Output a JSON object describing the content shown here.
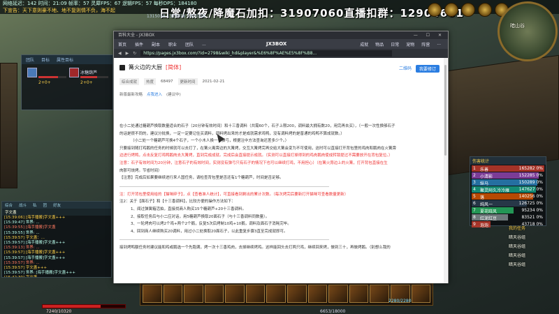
{
  "hud": {
    "top_line1": "网络延迟：142  时间：21:09  帧率：57  灵犀FPS：67  逻辑FPS：57  每秒DPS：184180",
    "top_line2": "下宣告：天下意则豪不地、地不复则情不负，海不起",
    "stream_title": "日常/熬夜/降魔石加扣：31907060直播扣群：12904681",
    "coords": "1315018 1315018 1315018",
    "minimap_label": "暗山谷",
    "party_tabs": [
      "团队",
      "目标",
      "属性目标"
    ],
    "party_members": [
      {
        "name": "",
        "level": "2+0+",
        "hp": 0.7,
        "icon_color": "#4a7ab8"
      },
      {
        "name": "冰糖葫芦",
        "level": "2+0+",
        "hp": 0.6,
        "icon_color": "#a0282a"
      }
    ],
    "chat_tabs": [
      "综合",
      "战斗",
      "私",
      "团",
      "好友"
    ],
    "chat_channel": "字文盏",
    "chat_lines": [
      {
        "text": "[15:39:06] [海手播搬]字文盏+++",
        "cls": "y"
      },
      {
        "text": "[15:39:47] 世界: ...",
        "cls": ""
      },
      {
        "text": "[15:39:55] [海手播搬]字文盏",
        "cls": "r"
      },
      {
        "text": "[15:39:55] 世界: ...",
        "cls": ""
      },
      {
        "text": "[15:39:57] 字文盏：...",
        "cls": "y"
      },
      {
        "text": "[15:39:57] [海手播搬]字文盏+++",
        "cls": ""
      },
      {
        "text": "[15:39:13] 世界: ...",
        "cls": "r"
      },
      {
        "text": "[15:39:57] [海手播搬]字文盏+++",
        "cls": "y"
      },
      {
        "text": "[15:39:57] [海手播搬]字文盏+++",
        "cls": ""
      },
      {
        "text": "[15:39:57] 世界: ...",
        "cls": "r"
      },
      {
        "text": "[15:39:57] 字文盏+++",
        "cls": "y"
      },
      {
        "text": "[15:39:57] 世界: [海手播搬]字文盏+++",
        "cls": ""
      },
      {
        "text": "[15:42:30] 字文盏",
        "cls": "y"
      }
    ],
    "damage_title": "伤害统计",
    "damage_rows": [
      {
        "rank": "1",
        "name": "乐善",
        "value": "165282 0%",
        "frac": 1.0,
        "color": "#c0392b"
      },
      {
        "rank": "2",
        "name": "小清影",
        "value": "152285 0%",
        "frac": 0.92,
        "color": "#8e44ad"
      },
      {
        "rank": "3",
        "name": "纵马",
        "value": "150289 0%",
        "frac": 0.9,
        "color": "#2980b9"
      },
      {
        "rank": "4",
        "name": "聚灵阿久冷冷雁",
        "value": "147627 0%",
        "frac": 0.88,
        "color": "#16a085"
      },
      {
        "rank": "5",
        "name": "落",
        "value": "140256 0%",
        "frac": 0.85,
        "color": "#d35400"
      },
      {
        "rank": "6",
        "name": "纯风一",
        "value": "126725 0%",
        "frac": 0.76,
        "color": "#2c3e50"
      },
      {
        "rank": "7",
        "name": "夏花晓风",
        "value": "95234 0%",
        "frac": 0.58,
        "color": "#27ae60"
      },
      {
        "rank": "8",
        "name": "红泥红豆",
        "value": "83521 0%",
        "frac": 0.5,
        "color": "#7f8c8d"
      },
      {
        "rank": "9",
        "name": "泡泡",
        "value": "43718 0%",
        "frac": 0.26,
        "color": "#c0392b"
      }
    ],
    "tasks": [
      {
        "text": "我的任务",
        "cls": "h"
      },
      {
        "text": "暗天谷组",
        "cls": ""
      },
      {
        "text": "暗天谷组",
        "cls": ""
      },
      {
        "text": "暗天谷组",
        "cls": ""
      },
      {
        "text": "暗天谷组",
        "cls": ""
      }
    ],
    "hp_text": "7240/10320",
    "hp_frac": 0.7,
    "mp_text": "6653/18000",
    "orb_text": "2280/2280"
  },
  "browser": {
    "window_title": "百科大全 - JX3BOX",
    "window_controls": "— ☐ ✕",
    "nav_items": [
      "首页",
      "插件",
      "副本",
      "职业",
      "团队",
      "..."
    ],
    "brand": "JX3BOX",
    "nav_right": [
      "成就",
      "物品",
      "日常",
      "宠物",
      "阵营",
      "..."
    ],
    "url": "https://pages.jx3box.com/?id=2798&wiki_hd&player&%E6%8F%AE%E5%8F%B8..."
  },
  "article": {
    "title": "篝火边的大厨",
    "tag": "[简体]",
    "qr_label": "二维码",
    "subscribe_label": "我要修订",
    "meta": {
      "category": "综合成就",
      "score_label": "热度",
      "score": "68497",
      "date_label": "更新时间",
      "date": "2021-02-21"
    },
    "crumbs": [
      "新版最新攻略",
      "点我进入",
      "(建议中)"
    ],
    "lines": [
      {
        "text": "在小二处通过糖葫芦换取数量适合的石子（20分钟有效时间）和十三香调料（共需60个，石子上限200，调料最大拥有数20，用完再去买），（一般一次性换够石子",
        "cls": ""
      },
      {
        "text": "的话是很不同的，建议分批换，一定一定要记住买调料，调料烤出来的才是成就需求鸡鸭，没有调料烤的是普通的鸡鸭不算成就数。）",
        "cls": ""
      },
      {
        "text": "（小二处一个糖葫芦可换4个石子，一个小木人换一个弹弓，根据注中方法查询还差多少个。）",
        "cls": "ind"
      },
      {
        "text": "只要接到随打鸡鹅的任务的时候就可以去打了，在篝火离旁边的大篝烤，交互大篝烤完再交给大篝会变为不可使用，这时可以直接打开背包里的鸡肉和鹅肉在火篝旁",
        "cls": ""
      },
      {
        "text": "边进行烤鸭，点击反复打鸡鸭鹅肉去大篝烤，直到完成成就。完成后会直接提示成就。（实测可以直接打掉得到的鸡肉鹅肉使成转锁提过不需要放开在背包复位。）",
        "cls": "red"
      },
      {
        "text": "注意：石子有效时间为20分钟，注意石子的有效时间，实测没有弹弓只有石子的情况下也可以继续打鸡，不用担心）（在篝火旁边上的火篝，打开背包直接在生",
        "cls": "red"
      },
      {
        "text": "肉那可烧烤。节省时间）",
        "cls": ""
      },
      {
        "text": "【注意】完成后如果要继续进行来人国任务，请检查背包里是否还有1个糖葫芦，时间是否足够。",
        "cls": ""
      },
      {
        "text": "",
        "cls": "sep"
      },
      {
        "text": "注：打开背包里使用给的【猫咪碎子】，点【查看准人统计】，可直接看到剩出的累计次数。（每次烤完后要新打开猫咪可查看数量更新）",
        "cls": "red"
      },
      {
        "text": "注2：关于【面石子】和【十三香调料】，比较方便的操作方法如下：",
        "cls": ""
      },
      {
        "text": "1、闻过弹簧箱活拍，直接找商人购买15个糖葫芦+20十三香调料。",
        "cls": "ind"
      },
      {
        "text": "2、接取任务后与小二应对话，用5糖葫芦换取20面石子（与十三香调料同数量）。",
        "cls": "ind"
      },
      {
        "text": "3、一轮烤肉可以烤2个鸡+两个2个鹅，反复5次后烤制10鸡+10鹅，调料及面石子消耗完毕。",
        "cls": "ind"
      },
      {
        "text": "4、回到商人继续购买20调料，用过小二处换取20面石子，以此重复步骤3直至完成就即可。",
        "cls": "ind"
      },
      {
        "text": "",
        "cls": "sep"
      },
      {
        "text": "接到烤鸭额任务时建议能和鸡或鹅选一个先跑满，烤一次十三香鸡肉，去掉继续烤鸡。这样能回头去打两只鸡，继续回来烤，做到三十，再做烤鹅。（别想么我的",
        "cls": ""
      }
    ]
  }
}
